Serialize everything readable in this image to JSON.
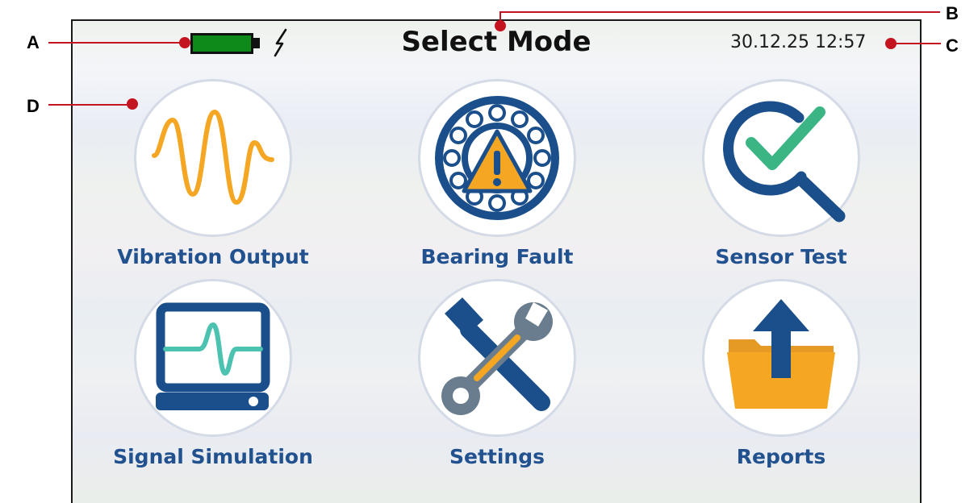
{
  "header": {
    "title": "Select Mode",
    "datetime": "30.12.25 12:57",
    "battery_icon": "battery-full-icon",
    "charging_icon": "lightning-icon"
  },
  "modes": [
    {
      "label": "Vibration Output",
      "icon": "sine-wave-icon"
    },
    {
      "label": "Bearing Fault",
      "icon": "bearing-warning-icon"
    },
    {
      "label": "Sensor Test",
      "icon": "magnifier-check-icon"
    },
    {
      "label": "Signal Simulation",
      "icon": "monitor-waveform-icon"
    },
    {
      "label": "Settings",
      "icon": "wrench-screwdriver-icon"
    },
    {
      "label": "Reports",
      "icon": "folder-upload-icon"
    }
  ],
  "callouts": {
    "a": "A",
    "b": "B",
    "c": "C",
    "d": "D"
  },
  "colors": {
    "accent_blue": "#21518f",
    "battery_green": "#0d8a1a",
    "callout_red": "#c4141f",
    "wave_orange": "#f5a623",
    "check_green": "#3bb583",
    "teal": "#4cc2b1"
  }
}
